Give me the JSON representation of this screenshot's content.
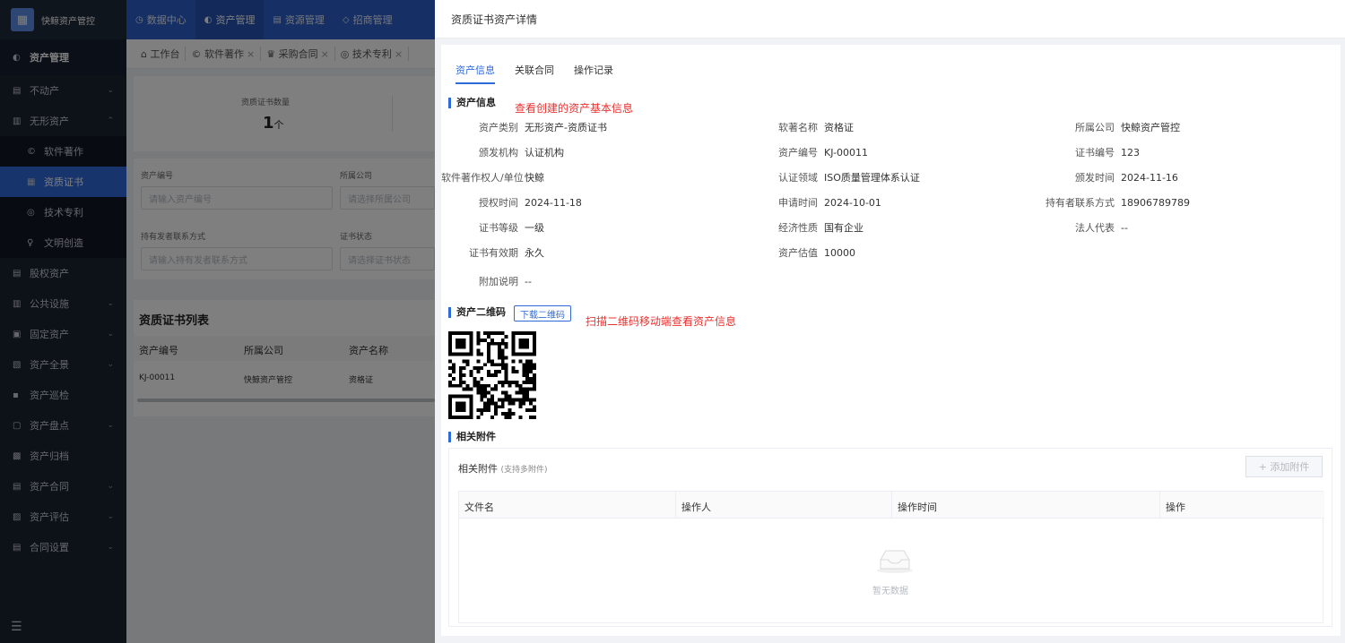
{
  "app": {
    "title": "快鲸资产管控",
    "logo_glyph": "▦"
  },
  "sidebar": {
    "header": "资产管理",
    "items": [
      {
        "label": "不动产",
        "icon": "building-icon",
        "glyph": "▤",
        "chevron": "⌄"
      },
      {
        "label": "无形资产",
        "icon": "file-icon",
        "glyph": "▥",
        "chevron": "⌃"
      },
      {
        "label": "软件著作",
        "icon": "copyright-icon",
        "glyph": "©"
      },
      {
        "label": "资质证书",
        "icon": "certificate-icon",
        "glyph": "▦"
      },
      {
        "label": "技术专利",
        "icon": "patent-icon",
        "glyph": "◎"
      },
      {
        "label": "文明创造",
        "icon": "bulb-icon",
        "glyph": "♀"
      },
      {
        "label": "股权资产",
        "icon": "equity-icon",
        "glyph": "▤"
      },
      {
        "label": "公共设施",
        "icon": "facility-icon",
        "glyph": "▥",
        "chevron": "⌄"
      },
      {
        "label": "固定资产",
        "icon": "fixed-asset-icon",
        "glyph": "▣",
        "chevron": "⌄"
      },
      {
        "label": "资产全景",
        "icon": "panorama-icon",
        "glyph": "▧",
        "chevron": "⌄"
      },
      {
        "label": "资产巡检",
        "icon": "inspect-icon",
        "glyph": "▪"
      },
      {
        "label": "资产盘点",
        "icon": "inventory-icon",
        "glyph": "▢",
        "chevron": "⌄"
      },
      {
        "label": "资产归档",
        "icon": "archive-icon",
        "glyph": "▩"
      },
      {
        "label": "资产合同",
        "icon": "contract-icon",
        "glyph": "▤",
        "chevron": "⌄"
      },
      {
        "label": "资产评估",
        "icon": "evaluate-icon",
        "glyph": "▨",
        "chevron": "⌄"
      },
      {
        "label": "合同设置",
        "icon": "settings-icon",
        "glyph": "▤",
        "chevron": "⌄"
      }
    ],
    "collapse_glyph": "☰"
  },
  "topnav": [
    {
      "label": "数据中心",
      "glyph": "◷"
    },
    {
      "label": "资产管理",
      "glyph": "◐"
    },
    {
      "label": "资源管理",
      "glyph": "▤"
    },
    {
      "label": "招商管理",
      "glyph": "◇"
    }
  ],
  "tabs": [
    {
      "label": "工作台",
      "glyph": "⌂",
      "close": ""
    },
    {
      "label": "软件著作",
      "glyph": "©",
      "close": "×"
    },
    {
      "label": "采购合同",
      "glyph": "♛",
      "close": "×"
    },
    {
      "label": "技术专利",
      "glyph": "◎",
      "close": "×"
    }
  ],
  "bg": {
    "stat_label": "资质证书数量",
    "stat_value": "1",
    "stat_unit": "个",
    "filters": [
      {
        "label": "资产编号",
        "placeholder": "请输入资产编号"
      },
      {
        "label": "所属公司",
        "placeholder": "请选择所属公司"
      },
      {
        "label": "持有发者联系方式",
        "placeholder": "请输入持有发者联系方式"
      },
      {
        "label": "证书状态",
        "placeholder": "请选择证书状态"
      }
    ],
    "list_title": "资质证书列表",
    "columns": [
      "资产编号",
      "所属公司",
      "资产名称"
    ],
    "row": [
      "KJ-00011",
      "快鲸资产管控",
      "资格证"
    ]
  },
  "drawer": {
    "title": "资质证书资产详情",
    "tabs": [
      "资产信息",
      "关联合同",
      "操作记录"
    ],
    "info_title": "资产信息",
    "info_annotation": "查看创建的资产基本信息",
    "fields": [
      {
        "label": "资产类别",
        "value": "无形资产-资质证书"
      },
      {
        "label": "软著名称",
        "value": "资格证"
      },
      {
        "label": "所属公司",
        "value": "快鲸资产管控"
      },
      {
        "label": "颁发机构",
        "value": "认证机构"
      },
      {
        "label": "资产编号",
        "value": "KJ-00011"
      },
      {
        "label": "证书编号",
        "value": "123"
      },
      {
        "label": "软件著作权人/单位",
        "value": "快鲸"
      },
      {
        "label": "认证领域",
        "value": "ISO质量管理体系认证"
      },
      {
        "label": "颁发时间",
        "value": "2024-11-16"
      },
      {
        "label": "授权时间",
        "value": "2024-11-18"
      },
      {
        "label": "申请时间",
        "value": "2024-10-01"
      },
      {
        "label": "持有者联系方式",
        "value": "18906789789"
      },
      {
        "label": "证书等级",
        "value": "一级"
      },
      {
        "label": "经济性质",
        "value": "国有企业"
      },
      {
        "label": "法人代表",
        "value": "--"
      },
      {
        "label": "证书有效期",
        "value": "永久"
      },
      {
        "label": "资产估值",
        "value": "10000"
      },
      {
        "label": "附加说明",
        "value": "--"
      }
    ],
    "qr_title": "资产二维码",
    "qr_button": "下载二维码",
    "qr_annotation": "扫描二维码移动端查看资产信息",
    "attach_title": "相关附件",
    "attach_head": "相关附件",
    "attach_hint": "(支持多附件)",
    "add_button": "+ 添加附件",
    "columns": [
      "文件名",
      "操作人",
      "操作时间",
      "操作"
    ],
    "empty_text": "暂无数据"
  },
  "colors": {
    "primary": "#2f6bd8",
    "annotation": "#e8312f",
    "sidebar": "#1b2431"
  }
}
